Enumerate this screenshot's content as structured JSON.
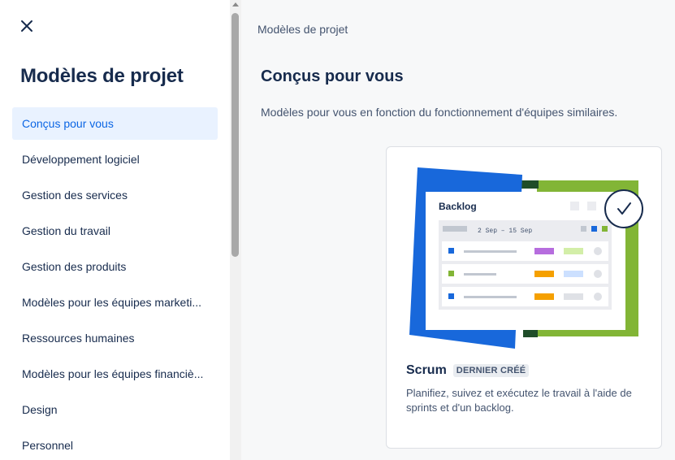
{
  "sidebar": {
    "close_icon": "close-icon",
    "title": "Modèles de projet",
    "items": [
      {
        "label": "Conçus pour vous",
        "active": true
      },
      {
        "label": "Développement logiciel"
      },
      {
        "label": "Gestion des services"
      },
      {
        "label": "Gestion du travail"
      },
      {
        "label": "Gestion des produits"
      },
      {
        "label": "Modèles pour les équipes marketi..."
      },
      {
        "label": "Ressources humaines"
      },
      {
        "label": "Modèles pour les équipes financiè..."
      },
      {
        "label": "Design"
      },
      {
        "label": "Personnel"
      }
    ]
  },
  "main": {
    "breadcrumb": "Modèles de projet",
    "section_title": "Conçus pour vous",
    "section_desc": "Modèles pour vous en fonction du fonctionnement d'équipes similaires.",
    "card": {
      "name": "Scrum",
      "badge": "DERNIER CRÉÉ",
      "description": "Planifiez, suivez et exécutez le travail à l'aide de sprints et d'un backlog.",
      "illustration": {
        "title": "Backlog",
        "sprint_label": "2 Sep – 15 Sep"
      }
    }
  },
  "colors": {
    "accent": "#0c66e4",
    "active_bg": "#e9f2ff",
    "illus_blue": "#1868db",
    "illus_green": "#82b536",
    "illus_dark_green": "#1f4d29"
  }
}
